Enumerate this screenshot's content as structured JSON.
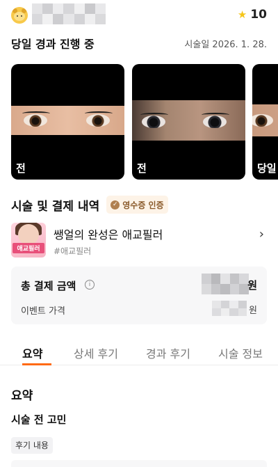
{
  "header": {
    "points": "10",
    "star_color": "#f5c518"
  },
  "progress": {
    "title": "당일 경과 진행 중",
    "procedure_date": "시술일 2026. 1. 28."
  },
  "photos": [
    {
      "caption": "전"
    },
    {
      "caption": "전"
    },
    {
      "caption": "당일"
    }
  ],
  "payment": {
    "title": "시술 및 결제 내역",
    "receipt_badge": "영수증 인증",
    "product": {
      "name": "쌩얼의 완성은 애교필러",
      "tag": "#애교필러",
      "thumb_label": "애교필러"
    },
    "total_label": "총 결제 금액",
    "total_unit": "원",
    "event_label": "이벤트 가격",
    "event_unit": "원"
  },
  "tabs": [
    {
      "label": "요약",
      "active": true
    },
    {
      "label": "상세 후기",
      "active": false
    },
    {
      "label": "경과 후기",
      "active": false
    },
    {
      "label": "시술 정보",
      "active": false
    }
  ],
  "summary": {
    "title": "요약",
    "concern_title": "시술 전 고민",
    "review_chip": "후기 내용"
  },
  "colors": {
    "accent": "#ff6a14",
    "badge_bg": "#fdf3e7",
    "badge_text": "#8a5a2a"
  }
}
